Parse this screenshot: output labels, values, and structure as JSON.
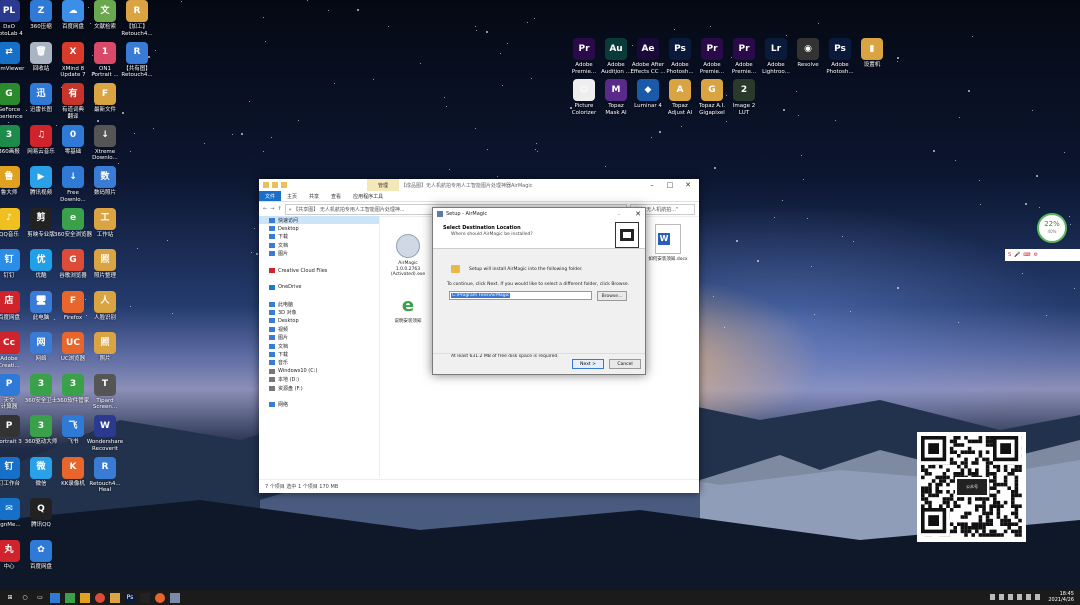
{
  "desktop": {
    "left_icons": [
      {
        "label": "DxO\nhotoLab 4",
        "color": "#2b3a8f",
        "glyph": "PL",
        "col": 0,
        "row": 0
      },
      {
        "label": "360压缩",
        "color": "#2f7ad6",
        "glyph": "Z",
        "col": 1,
        "row": 0
      },
      {
        "label": "百度网盘",
        "color": "#3b8fe8",
        "glyph": "☁",
        "col": 2,
        "row": 0
      },
      {
        "label": "文献检索",
        "color": "#6aa84f",
        "glyph": "文",
        "col": 3,
        "row": 0
      },
      {
        "label": "【加工】\nRetouch4...",
        "color": "#d9a441",
        "glyph": "R",
        "col": 4,
        "row": 0
      },
      {
        "label": "eamViewer",
        "color": "#1670c8",
        "glyph": "⇄",
        "col": 0,
        "row": 1
      },
      {
        "label": "回收站",
        "color": "#aab4c2",
        "glyph": "🗑",
        "col": 1,
        "row": 1
      },
      {
        "label": "XMind 8\nUpdate 7",
        "color": "#d83b2b",
        "glyph": "X",
        "col": 2,
        "row": 1
      },
      {
        "label": "ON1\nPortrait ...",
        "color": "#d94a6a",
        "glyph": "1",
        "col": 3,
        "row": 1
      },
      {
        "label": "【共有图】\nRetouch4...",
        "color": "#3a7bd5",
        "glyph": "R",
        "col": 4,
        "row": 1
      },
      {
        "label": "GeForce\nxperience",
        "color": "#2b8a2b",
        "glyph": "G",
        "col": 0,
        "row": 2
      },
      {
        "label": "迅雷长图",
        "color": "#2f7ad6",
        "glyph": "迅",
        "col": 1,
        "row": 2
      },
      {
        "label": "有道词典\n翻译",
        "color": "#c8332b",
        "glyph": "有",
        "col": 2,
        "row": 2
      },
      {
        "label": "最新文件",
        "color": "#d9a441",
        "glyph": "F",
        "col": 3,
        "row": 2
      },
      {
        "label": "360画报",
        "color": "#1d8c4a",
        "glyph": "3",
        "col": 0,
        "row": 3
      },
      {
        "label": "网易云音乐",
        "color": "#d1232b",
        "glyph": "♫",
        "col": 1,
        "row": 3
      },
      {
        "label": "零基础",
        "color": "#2f7ad6",
        "glyph": "0",
        "col": 2,
        "row": 3
      },
      {
        "label": "Xtreme\nDownlo...",
        "color": "#555555",
        "glyph": "↓",
        "col": 3,
        "row": 3
      },
      {
        "label": "鲁大师",
        "color": "#e0a020",
        "glyph": "鲁",
        "col": 0,
        "row": 4
      },
      {
        "label": "腾讯视频",
        "color": "#2aa0e8",
        "glyph": "▶",
        "col": 1,
        "row": 4
      },
      {
        "label": "Free\nDownlo...",
        "color": "#2f7ad6",
        "glyph": "↓",
        "col": 2,
        "row": 4
      },
      {
        "label": "数码照片",
        "color": "#3a7bd5",
        "glyph": "数",
        "col": 3,
        "row": 4
      },
      {
        "label": "QQ音乐",
        "color": "#f0c020",
        "glyph": "♪",
        "col": 0,
        "row": 5
      },
      {
        "label": "剪映专业版",
        "color": "#222222",
        "glyph": "剪",
        "col": 1,
        "row": 5
      },
      {
        "label": "360安全浏览器",
        "color": "#3aa04a",
        "glyph": "e",
        "col": 2,
        "row": 5
      },
      {
        "label": "工作站",
        "color": "#d9a441",
        "glyph": "工",
        "col": 3,
        "row": 5
      },
      {
        "label": "钉钉",
        "color": "#2a8de8",
        "glyph": "钉",
        "col": 0,
        "row": 6
      },
      {
        "label": "优酷",
        "color": "#1fa0e8",
        "glyph": "优",
        "col": 1,
        "row": 6
      },
      {
        "label": "谷歌浏览器",
        "color": "#dd4b39",
        "glyph": "G",
        "col": 2,
        "row": 6
      },
      {
        "label": "照片整理",
        "color": "#d9a441",
        "glyph": "照",
        "col": 3,
        "row": 6
      },
      {
        "label": "百度网盘",
        "color": "#d1232b",
        "glyph": "店",
        "col": 0,
        "row": 7
      },
      {
        "label": "此电脑",
        "color": "#3a7bd5",
        "glyph": "🖥",
        "col": 1,
        "row": 7
      },
      {
        "label": "Firefox",
        "color": "#e8662b",
        "glyph": "F",
        "col": 2,
        "row": 7
      },
      {
        "label": "人脸识别",
        "color": "#d9a441",
        "glyph": "人",
        "col": 3,
        "row": 7
      },
      {
        "label": "Adobe\nCreati...",
        "color": "#d1232b",
        "glyph": "Cc",
        "col": 0,
        "row": 8
      },
      {
        "label": "网络",
        "color": "#3a7bd5",
        "glyph": "网",
        "col": 1,
        "row": 8
      },
      {
        "label": "UC浏览器",
        "color": "#e8662b",
        "glyph": "UC",
        "col": 2,
        "row": 8
      },
      {
        "label": "照片",
        "color": "#d9a441",
        "glyph": "照",
        "col": 3,
        "row": 8
      },
      {
        "label": "天文\n计算器",
        "color": "#2f7ad6",
        "glyph": "P",
        "col": 0,
        "row": 9
      },
      {
        "label": "360安全卫士",
        "color": "#3aa04a",
        "glyph": "3",
        "col": 1,
        "row": 9
      },
      {
        "label": "360软件管家",
        "color": "#3aa04a",
        "glyph": "3",
        "col": 2,
        "row": 9
      },
      {
        "label": "Tipard\nScreen...",
        "color": "#555555",
        "glyph": "T",
        "col": 3,
        "row": 9
      },
      {
        "label": "Portrait 3",
        "color": "#333333",
        "glyph": "P",
        "col": 0,
        "row": 10
      },
      {
        "label": "360驱动大师",
        "color": "#3aa04a",
        "glyph": "3",
        "col": 1,
        "row": 10
      },
      {
        "label": "飞书",
        "color": "#2f7ad6",
        "glyph": "飞",
        "col": 2,
        "row": 10
      },
      {
        "label": "Wondershare\nRecoverit",
        "color": "#2b3a8f",
        "glyph": "W",
        "col": 3,
        "row": 10
      },
      {
        "label": "钉工作台",
        "color": "#1670c8",
        "glyph": "钉",
        "col": 0,
        "row": 11
      },
      {
        "label": "微信",
        "color": "#2aa0e8",
        "glyph": "微",
        "col": 1,
        "row": 11
      },
      {
        "label": "KK录像机",
        "color": "#e8662b",
        "glyph": "K",
        "col": 2,
        "row": 11
      },
      {
        "label": "Retouch4...\nHeal",
        "color": "#3a7bd5",
        "glyph": "R",
        "col": 3,
        "row": 11
      },
      {
        "label": "sgnMe...",
        "color": "#1670c8",
        "glyph": "✉",
        "col": 0,
        "row": 12
      },
      {
        "label": "腾讯QQ",
        "color": "#222222",
        "glyph": "Q",
        "col": 1,
        "row": 12
      },
      {
        "label": "中心",
        "color": "#d1232b",
        "glyph": "丸",
        "col": 0,
        "row": 13
      },
      {
        "label": "百度网盘",
        "color": "#2f7ad6",
        "glyph": "✿",
        "col": 1,
        "row": 13
      }
    ],
    "right_icons": [
      {
        "label": "Adobe\nPremie...",
        "color": "#2a0a4a",
        "glyph": "Pr",
        "col": 0,
        "row": 0
      },
      {
        "label": "Adobe\nAudition ...",
        "color": "#0a3a3a",
        "glyph": "Au",
        "col": 1,
        "row": 0
      },
      {
        "label": "Adobe After\nEffects CC ...",
        "color": "#1a0a3a",
        "glyph": "Ae",
        "col": 2,
        "row": 0
      },
      {
        "label": "Adobe\nPhotosh...",
        "color": "#0a1a3a",
        "glyph": "Ps",
        "col": 3,
        "row": 0
      },
      {
        "label": "Adobe\nPremie...",
        "color": "#2a0a4a",
        "glyph": "Pr",
        "col": 4,
        "row": 0
      },
      {
        "label": "Adobe\nPremie...",
        "color": "#2a0a4a",
        "glyph": "Pr",
        "col": 5,
        "row": 0
      },
      {
        "label": "Adobe\nLightroo...",
        "color": "#0a1a3a",
        "glyph": "Lr",
        "col": 6,
        "row": 0
      },
      {
        "label": "Resolve",
        "color": "#333333",
        "glyph": "◉",
        "col": 7,
        "row": 0
      },
      {
        "label": "Adobe\nPhotosh...",
        "color": "#0a1a3a",
        "glyph": "Ps",
        "col": 8,
        "row": 0
      },
      {
        "label": "设置机",
        "color": "#d9a441",
        "glyph": "▮",
        "col": 9,
        "row": 0
      },
      {
        "label": "Picture\nColorizer",
        "color": "#eeeeee",
        "glyph": "☺",
        "col": 0,
        "row": 1
      },
      {
        "label": "Topaz\nMask AI",
        "color": "#5a2a8a",
        "glyph": "M",
        "col": 1,
        "row": 1
      },
      {
        "label": "Luminar 4",
        "color": "#1a5aa8",
        "glyph": "◆",
        "col": 2,
        "row": 1
      },
      {
        "label": "Topaz\nAdjust AI",
        "color": "#d9a441",
        "glyph": "A",
        "col": 3,
        "row": 1
      },
      {
        "label": "Topaz A.I.\nGigapixel",
        "color": "#d9a441",
        "glyph": "G",
        "col": 4,
        "row": 1
      },
      {
        "label": "Image 2\nLUT",
        "color": "#2a3a2a",
        "glyph": "2",
        "col": 5,
        "row": 1
      }
    ]
  },
  "explorer": {
    "ribbon_tabs": [
      "文件",
      "主页",
      "共享",
      "查看",
      "应用程序工具"
    ],
    "context_tab": "管理",
    "window_title": "【成品图】无人机航拍专用人工智能图片处理神器AirMagic",
    "address": "« 【共享图】 无人机航拍专用人工智能图片处理神...",
    "search_placeholder": "搜索\"无人机航拍...\"",
    "nav_items": [
      {
        "label": "快速访问",
        "color": "#3a7bd5"
      },
      {
        "label": "Desktop",
        "color": "#3a7bd5"
      },
      {
        "label": "下载",
        "color": "#3a7bd5"
      },
      {
        "label": "文档",
        "color": "#3a7bd5"
      },
      {
        "label": "图片",
        "color": "#3a7bd5"
      },
      {
        "label": "",
        "color": "#ffffff"
      },
      {
        "label": "Creative Cloud Files",
        "color": "#d1232b"
      },
      {
        "label": "",
        "color": "#ffffff"
      },
      {
        "label": "OneDrive",
        "color": "#1a78d6"
      },
      {
        "label": "",
        "color": "#ffffff"
      },
      {
        "label": "此电脑",
        "color": "#3a7bd5"
      },
      {
        "label": "3D 对象",
        "color": "#3a7bd5"
      },
      {
        "label": "Desktop",
        "color": "#3a7bd5"
      },
      {
        "label": "视频",
        "color": "#3a7bd5"
      },
      {
        "label": "图片",
        "color": "#3a7bd5"
      },
      {
        "label": "文档",
        "color": "#3a7bd5"
      },
      {
        "label": "下载",
        "color": "#3a7bd5"
      },
      {
        "label": "音乐",
        "color": "#3a7bd5"
      },
      {
        "label": "Windows10 (C:)",
        "color": "#777777"
      },
      {
        "label": "本地 (D:)",
        "color": "#777777"
      },
      {
        "label": "资源盘 (F:)",
        "color": "#777777"
      },
      {
        "label": "",
        "color": "#ffffff"
      },
      {
        "label": "网络",
        "color": "#3a7bd5"
      }
    ],
    "files": [
      {
        "label": "AirMagic\n1.0.0.2763\n(Activated).exe"
      },
      {
        "label": "如何安装须知.docx"
      },
      {
        "label": "说明安装须知"
      }
    ],
    "status": "7 个项目    选中 1 个项目  170 MB"
  },
  "setup": {
    "title": "Setup - AirMagic",
    "heading": "Select Destination Location",
    "subheading": "Where should AirMagic be installed?",
    "install_msg": "Setup will install AirMagic into the following folder.",
    "continue_msg": "To continue, click Next. If you would like to select a different folder, click Browse.",
    "path_value": "C:\\Program Files\\AirMagic",
    "browse_label": "Browse...",
    "space_msg": "At least 631.2 MB of free disk space is required.",
    "next_label": "Next >",
    "cancel_label": "Cancel"
  },
  "widget": {
    "gauge_value": "22%",
    "gauge_sub": "40%"
  },
  "qr": {
    "label": "公众号"
  },
  "taskbar": {
    "time": "18:45",
    "date": "2021/4/26"
  }
}
